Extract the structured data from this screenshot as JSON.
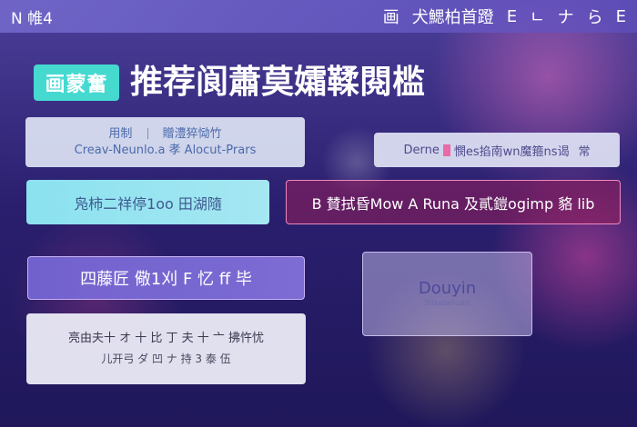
{
  "topbar": {
    "brand": "N 帷4",
    "actions": [
      "画",
      "犬鰓柏首蹬",
      "E",
      "ㄴ",
      "ナ",
      "ら",
      "E"
    ]
  },
  "hero": {
    "badge": "画蒙奮",
    "title": "推荐阆蕭莫孀鞣閱槛"
  },
  "cards": {
    "card1": {
      "line1_a": "用制",
      "line1_b": "贈澧猝恸竹",
      "line2": "Creav-Neunlo.a 孝 Alocut-Prars"
    },
    "card2": {
      "text_a": "Derne",
      "text_b": "憫es掐南wn魔箍ns谒",
      "text_c": "常"
    },
    "card3": {
      "text": "凫柿二祥停1oo 田湖隨"
    },
    "card4": {
      "text": "B 賛拭昏Mow A Runa 及貳鎧ogimp 貉 lib"
    },
    "card5": {
      "text": "四藤匠 儆1刈 F 忆 ff 毕"
    },
    "card6": {
      "name": "Douyin",
      "sub": "Slisalalluan"
    },
    "card7": {
      "line1": "亮由夫十 オ 十 比 丁 夫 十 亠 拂忤忧",
      "line2": "儿开弓 ダ 凹 ナ 持 3 泰 伍"
    }
  },
  "colors": {
    "accent_teal": "#45d9d0",
    "topbar_violet": "#7a6ed2",
    "card_pink_border": "#ff96c8",
    "text_blue": "#4b6aaa"
  }
}
